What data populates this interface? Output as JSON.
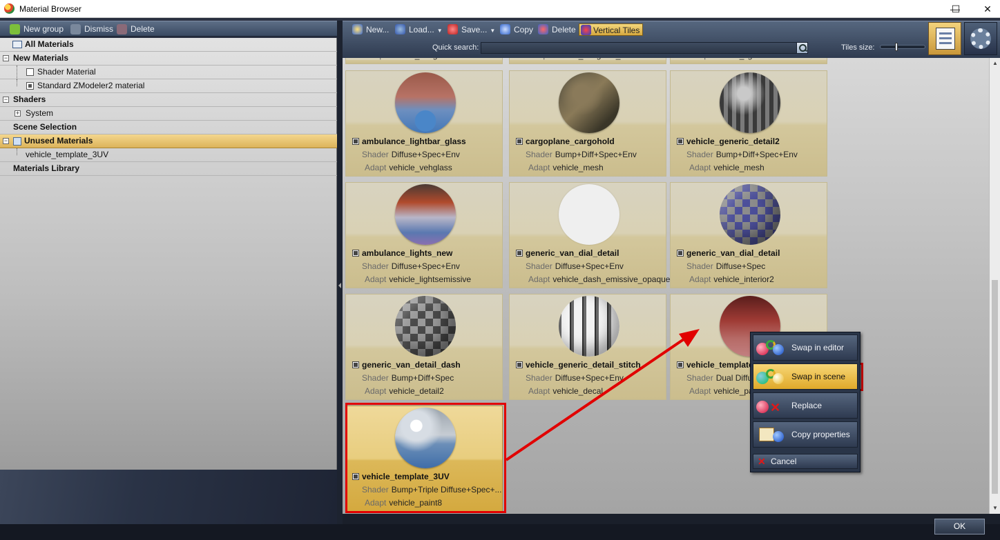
{
  "window": {
    "title": "Material Browser",
    "minimize": "—",
    "maximize": "☐",
    "close": "✕"
  },
  "left_toolbar": {
    "new_group": "New group",
    "dismiss": "Dismiss",
    "delete": "Delete"
  },
  "tree": {
    "all_materials": "All Materials",
    "new_materials": "New Materials",
    "shader_material": "Shader Material",
    "standard_material": "Standard ZModeler2 material",
    "shaders": "Shaders",
    "system": "System",
    "scene_selection": "Scene Selection",
    "unused_materials": "Unused Materials",
    "vehicle_template": "vehicle_template_3UV",
    "materials_library": "Materials Library"
  },
  "toolbar": {
    "new": "New...",
    "load": "Load...",
    "save": "Save...",
    "copy": "Copy",
    "delete": "Delete",
    "vertical_tiles": "Vertical Tiles",
    "quick_search_label": "Quick search:",
    "quick_search_value": "",
    "tiles_size_label": "Tiles size:",
    "tiles_size_level": 0.35
  },
  "labels": {
    "shader": "Shader",
    "adapt": "Adapt"
  },
  "partial_tiles": [
    {
      "adapt": "vehicle_vehglass"
    },
    {
      "adapt": "vehicle_vehglass_inner"
    },
    {
      "adapt": "vehicle_lights"
    }
  ],
  "tiles": [
    {
      "name": "ambulance_lightbar_glass",
      "shader": "Diffuse+Spec+Env",
      "adapt": "vehicle_vehglass"
    },
    {
      "name": "cargoplane_cargohold",
      "shader": "Bump+Diff+Spec+Env",
      "adapt": "vehicle_mesh"
    },
    {
      "name": "vehicle_generic_detail2",
      "shader": "Bump+Diff+Spec+Env",
      "adapt": "vehicle_mesh"
    },
    {
      "name": "ambulance_lights_new",
      "shader": "Diffuse+Spec+Env",
      "adapt": "vehicle_lightsemissive"
    },
    {
      "name": "generic_van_dial_detail",
      "shader": "Diffuse+Spec+Env",
      "adapt": "vehicle_dash_emissive_opaque"
    },
    {
      "name": "generic_van_dial_detail",
      "shader": "Diffuse+Spec",
      "adapt": "vehicle_interior2"
    },
    {
      "name": "generic_van_detail_dash",
      "shader": "Bump+Diff+Spec",
      "adapt": "vehicle_detail2"
    },
    {
      "name": "vehicle_generic_detail_stitch",
      "shader": "Diffuse+Spec+Env",
      "adapt": "vehicle_decal"
    },
    {
      "name": "vehicle_template",
      "shader": "Dual Diffu",
      "adapt": "vehicle_pa"
    },
    {
      "name": "vehicle_template_3UV",
      "shader": "Bump+Triple Diffuse+Spec+...",
      "adapt": "vehicle_paint8"
    }
  ],
  "context_menu": {
    "swap_in_editor": "Swap in editor",
    "swap_in_scene": "Swap in scene",
    "replace": "Replace",
    "copy_properties": "Copy properties",
    "cancel": "Cancel"
  },
  "ok_button": "OK",
  "colors": {
    "annotation_red": "#e10000",
    "highlight_gold": "#e0a92a"
  }
}
